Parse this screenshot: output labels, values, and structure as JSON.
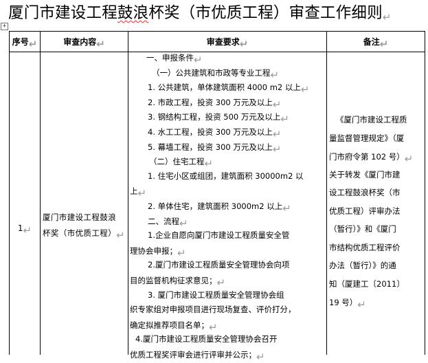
{
  "document": {
    "title_before": "厦门市建设工程",
    "title_marked": "鼓浪",
    "title_after": "杯奖（市优质工程）审查工作细则"
  },
  "table": {
    "headers": [
      "序号",
      "审查内容",
      "审查要求",
      "备注"
    ],
    "row": {
      "seq": "1",
      "content_lines": [
        "厦门市建设工程鼓浪",
        "杯奖（市优质工程）"
      ],
      "requirement_lines": [
        "一、申报条件",
        "（一）公共建筑和市政等专业工程",
        "1.  公共建筑，单体建筑面积 4000 m2 以上",
        "2.  市政工程，投资 300 万元及以上",
        "3.  钢结构工程，投资 500 万元及以上",
        "4.  水工工程，投资 300 万元及以上",
        "5.  幕墙工程，投资 300 万元及以上",
        "（二）住宅工程",
        "1.  住宅小区或组团，建筑面积 30000m2 以",
        "上",
        "2.  单体住宅，建筑面积 3000m2 以上",
        "二、流程",
        "1.企业自愿向厦门市建设工程质量安全管",
        "理协会申报；",
        "2.厦门市建设工程质量安全管理协会向项",
        "目的监督机构征求意见；",
        "3.  厦门市建设工程质量安全管理协会组",
        "织专家组对申报项目进行现场复查、评价打分，",
        "确定拟推荐项目名单；",
        "4.厦门市建设工程质量安全管理协会召开",
        "优质工程奖评审会进行评审并公示；"
      ],
      "note_lines": [
        "《厦门市建设工程质",
        "量监督管理规定》（厦",
        "门市府令第 102 号）",
        "关于转发《厦门市建",
        "设工程鼓浪杯奖（市",
        "优质工程）评审办法",
        "（暂行）》和《厦门",
        "市结构优质工程评价",
        "办法（暂行）》的通",
        "知（厦建工〔2011〕",
        "19 号）"
      ]
    }
  },
  "marks": {
    "paragraph_mark": "↵",
    "anchor_icon": "move-anchor-icon"
  },
  "colors": {
    "text": "#000000",
    "spellcheck_underline": "#e03030",
    "formatting_mark": "#9a9a9a"
  }
}
